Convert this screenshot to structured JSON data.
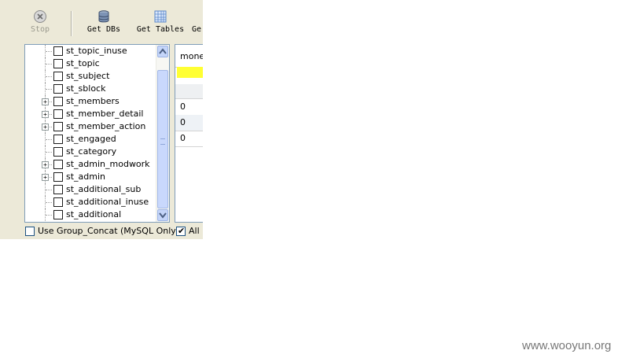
{
  "toolbar": {
    "stop_label": "Stop",
    "get_dbs_label": "Get DBs",
    "get_tables_label": "Get Tables",
    "truncated_label": "Ge"
  },
  "tree": {
    "items": [
      {
        "label": "st_topic_inuse",
        "expandable": false
      },
      {
        "label": "st_topic",
        "expandable": false
      },
      {
        "label": "st_subject",
        "expandable": false
      },
      {
        "label": "st_sblock",
        "expandable": false
      },
      {
        "label": "st_members",
        "expandable": true
      },
      {
        "label": "st_member_detail",
        "expandable": true
      },
      {
        "label": "st_member_action",
        "expandable": true
      },
      {
        "label": "st_engaged",
        "expandable": false
      },
      {
        "label": "st_category",
        "expandable": false
      },
      {
        "label": "st_admin_modwork",
        "expandable": true
      },
      {
        "label": "st_admin",
        "expandable": true
      },
      {
        "label": "st_additional_sub",
        "expandable": false
      },
      {
        "label": "st_additional_inuse",
        "expandable": false
      },
      {
        "label": "st_additional",
        "expandable": false
      }
    ]
  },
  "grid": {
    "column_header": "mone",
    "rows": [
      "0",
      "0",
      "0"
    ]
  },
  "options": {
    "group_concat_label": "Use Group_Concat (MySQL Only)",
    "group_concat_checked": false,
    "all_label": "All i",
    "all_checked": true
  },
  "watermark": "www.wooyun.org"
}
